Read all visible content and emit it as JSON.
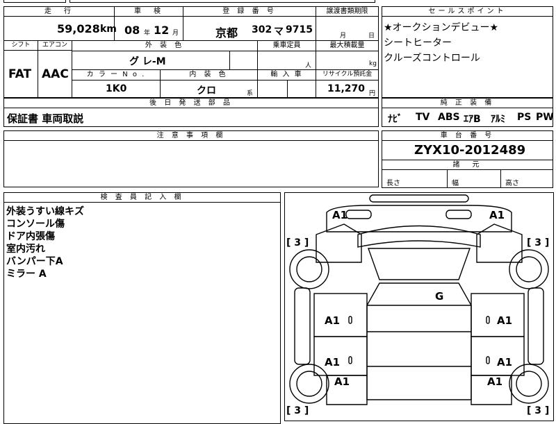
{
  "header": {
    "mileage_label": "走　行",
    "inspection_label": "車　検",
    "reg_label": "登 録 番 号",
    "transfer_label": "譲渡書類期限",
    "sales_label": "セールスポイント"
  },
  "mileage": {
    "value": "59,028",
    "unit": "km"
  },
  "inspection": {
    "year": "08",
    "year_unit": "年",
    "month": "12",
    "month_unit": "月"
  },
  "registration": {
    "region": "京都",
    "class_no": "302",
    "kana": "マ",
    "number": "9715"
  },
  "transfer": {
    "month_unit": "月",
    "day_unit": "日"
  },
  "sales_points": [
    "★オークションデビュー★",
    "シートヒーター",
    "クルーズコントロール"
  ],
  "row2": {
    "shift_label": "シフト",
    "shift_value": "FAT",
    "ac_label": "エアコン",
    "ac_value": "AAC",
    "exterior_label": "外 装 色",
    "exterior_value": "グ レ-M",
    "capacity_label": "乗車定員",
    "capacity_unit": "人",
    "load_label": "最大積載量",
    "load_unit": "kg",
    "colorno_label": "カ ラ ー N o .",
    "colorno_value": "1K0",
    "interior_label": "内 装 色",
    "interior_value": "クロ",
    "interior_unit": "系",
    "import_label": "輸 入 車",
    "recycle_label": "リサイクル預託金",
    "recycle_value": "11,270",
    "recycle_unit": "円"
  },
  "later_parts": {
    "label": "後 日 発 送 部 品",
    "value": "保証書 車両取説"
  },
  "equipment": {
    "label": "純 正 装 備",
    "items": [
      "ﾅﾋﾞ",
      "TV",
      "ABS",
      "ｴｱB",
      "ｱﾙﾐ",
      "PS",
      "PW"
    ]
  },
  "notes": {
    "label": "注 意 事 項 欄"
  },
  "chassis": {
    "label": "車 台 番 号",
    "value": "ZYX10-2012489"
  },
  "dims": {
    "label": "諸　元",
    "length": "長さ",
    "width": "幅",
    "height": "高さ"
  },
  "inspector": {
    "label": "検 査 員 記 入 欄",
    "lines": [
      "外装うすい線キズ",
      "コンソール傷",
      "ドア内張傷",
      "室内汚れ",
      "バンパー下A",
      "ミラー A"
    ]
  },
  "diagram": {
    "marks": [
      "A1",
      "A1",
      "A1",
      "A1",
      "A1",
      "A1",
      "A1",
      "A1",
      "G"
    ],
    "tire": "3"
  }
}
